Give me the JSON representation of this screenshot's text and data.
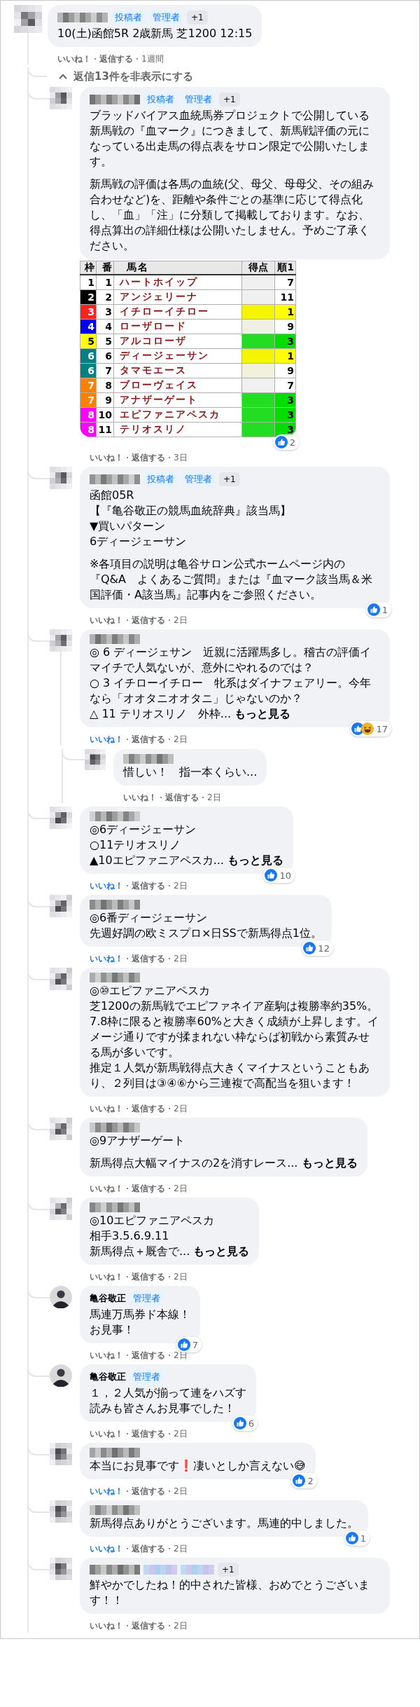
{
  "post_comment": {
    "author": {
      "kind": "blurred"
    },
    "avatar": {
      "kind": "mosaic"
    },
    "badges": [
      {
        "kind": "role",
        "label": "投稿者"
      },
      {
        "kind": "role",
        "label": "管理者"
      },
      {
        "kind": "more",
        "label": "+1"
      }
    ],
    "body": [
      [
        "10(土)函館5R 2歳新馬 芝1200 12:15"
      ]
    ],
    "actions": {
      "like": "いいね！",
      "reply": "返信する",
      "time": "1週間",
      "liked": false
    }
  },
  "toggle": {
    "label": "返信13件を非表示にする",
    "expanded": true
  },
  "replies": [
    {
      "author": {
        "kind": "blurred"
      },
      "avatar": {
        "kind": "mosaic"
      },
      "badges": [
        {
          "kind": "role",
          "label": "投稿者"
        },
        {
          "kind": "role",
          "label": "管理者"
        },
        {
          "kind": "more",
          "label": "+1"
        }
      ],
      "body": [
        [
          "ブラッドバイアス血統馬券プロジェクトで公開している新馬戦の『血マーク』につきまして、新馬戦評価の元になっている出走馬の得点表をサロン限定で公開いたします。"
        ],
        [
          "新馬戦の評価は各馬の血統(父、母父、母母父、その組み合わせなど)を、距離や条件ごとの基準に応じて得点化し、「血」「注」に分類して掲載しております。なお、得点算出の詳細仕様は公開いたしません。予めご了承ください。"
        ]
      ],
      "attachment": {
        "columns": [
          "枠",
          "番",
          "馬名",
          "得点",
          "順1"
        ],
        "rows": [
          {
            "frame": {
              "text": "1",
              "color": "#ffffff"
            },
            "number": "1",
            "name": "ハートホイップ",
            "score": {
              "color": "#f0f0f0"
            },
            "rank": {
              "text": "7",
              "color": "#ffffff"
            }
          },
          {
            "frame": {
              "text": "2",
              "color": "#000000"
            },
            "number": "2",
            "name": "アンジェリーナ",
            "score": {
              "color": "#f0f0f0"
            },
            "rank": {
              "text": "11",
              "color": "#ffffff"
            }
          },
          {
            "frame": {
              "text": "3",
              "color": "#ff2020"
            },
            "number": "3",
            "name": "イチローイチロー",
            "score": {
              "color": "#f5f500"
            },
            "rank": {
              "text": "1",
              "color": "#ffff00"
            }
          },
          {
            "frame": {
              "text": "4",
              "color": "#0000ee"
            },
            "number": "4",
            "name": "ローザロード",
            "score": {
              "color": "#f0f0e6"
            },
            "rank": {
              "text": "9",
              "color": "#ffffff"
            }
          },
          {
            "frame": {
              "text": "5",
              "color": "#ffff00"
            },
            "number": "5",
            "name": "アルコローザ",
            "score": {
              "color": "#22dd22"
            },
            "rank": {
              "text": "3",
              "color": "#00dd00"
            }
          },
          {
            "frame": {
              "text": "6",
              "color": "#008080"
            },
            "number": "6",
            "name": "ディージェーサン",
            "score": {
              "color": "#f5f500"
            },
            "rank": {
              "text": "1",
              "color": "#ffff00"
            }
          },
          {
            "frame": {
              "text": "6",
              "color": "#008080"
            },
            "number": "7",
            "name": "タマモエース",
            "score": {
              "color": "#f2f2dc"
            },
            "rank": {
              "text": "9",
              "color": "#ffffff"
            }
          },
          {
            "frame": {
              "text": "7",
              "color": "#ff8000"
            },
            "number": "8",
            "name": "ブローヴェイス",
            "score": {
              "color": "#f0f0f0"
            },
            "rank": {
              "text": "7",
              "color": "#ffffff"
            }
          },
          {
            "frame": {
              "text": "7",
              "color": "#ff8000"
            },
            "number": "9",
            "name": "アナザーゲート",
            "score": {
              "color": "#22dd22"
            },
            "rank": {
              "text": "3",
              "color": "#00dd00"
            }
          },
          {
            "frame": {
              "text": "8",
              "color": "#ff00ff"
            },
            "number": "10",
            "name": "エピファニアペスカ",
            "score": {
              "color": "#22dd22"
            },
            "rank": {
              "text": "3",
              "color": "#00dd00"
            }
          },
          {
            "frame": {
              "text": "8",
              "color": "#ff00ff"
            },
            "number": "11",
            "name": "テリオスリノ",
            "score": {
              "color": "#22dd22"
            },
            "rank": {
              "text": "3",
              "color": "#00dd00"
            }
          }
        ]
      },
      "reaction": {
        "count": "2",
        "types": [
          {
            "kind": "like"
          }
        ]
      },
      "actions": {
        "like": "いいね！",
        "reply": "返信する",
        "time": "3日",
        "liked": false
      }
    },
    {
      "author": {
        "kind": "blurred"
      },
      "avatar": {
        "kind": "mosaic"
      },
      "badges": [
        {
          "kind": "role",
          "label": "投稿者"
        },
        {
          "kind": "role",
          "label": "管理者"
        },
        {
          "kind": "more",
          "label": "+1"
        }
      ],
      "body": [
        [
          "函館05R",
          "【『亀谷敬正の競馬血統辞典』該当馬】",
          "▼買いパターン",
          "6ディージェーサン"
        ],
        [
          "※各項目の説明は亀谷サロン公式ホームページ内の『Q&A　よくあるご質問』または『血マーク該当馬＆米国評価・A該当馬』記事内をご参照ください。"
        ]
      ],
      "reaction": {
        "count": "1",
        "types": [
          {
            "kind": "like"
          }
        ]
      },
      "actions": {
        "like": "いいね！",
        "reply": "返信する",
        "time": "2日",
        "liked": false
      }
    },
    {
      "author": {
        "kind": "blurred"
      },
      "avatar": {
        "kind": "mosaic"
      },
      "body": [
        [
          "◎ 6 ディージェサン　近親に活躍馬多し。稽古の評価イマイチで人気ないが、意外にやれるのでは？",
          "○ 3 イチローイチロー　牝系はダイナフェアリー。今年なら「オオタニオオタニ」じゃないのか？",
          "△ 11 テリオスリノ　外枠..."
        ]
      ],
      "see_more": "もっと見る",
      "reaction": {
        "count": "17",
        "types": [
          {
            "kind": "like"
          },
          {
            "kind": "haha"
          }
        ]
      },
      "actions": {
        "like": "いいね！",
        "reply": "返信する",
        "time": "2日",
        "liked": true
      },
      "replies": [
        {
          "author": {
            "kind": "blurred"
          },
          "avatar": {
            "kind": "mosaic"
          },
          "body": [
            [
              "惜しい！　指一本くらい..."
            ]
          ],
          "actions": {
            "like": "いいね！",
            "reply": "返信する",
            "time": "2日",
            "liked": false
          }
        }
      ]
    },
    {
      "author": {
        "kind": "blurred"
      },
      "avatar": {
        "kind": "mosaic"
      },
      "body": [
        [
          "◎6ディージェーサン",
          "○11テリオスリノ",
          "▲10エピファニアペスカ..."
        ]
      ],
      "see_more": "もっと見る",
      "reaction": {
        "count": "10",
        "types": [
          {
            "kind": "like"
          }
        ]
      },
      "actions": {
        "like": "いいね！",
        "reply": "返信する",
        "time": "2日",
        "liked": true
      }
    },
    {
      "author": {
        "kind": "blurred"
      },
      "avatar": {
        "kind": "mosaic"
      },
      "body": [
        [
          "◎6番ディージェーサン",
          "先週好調の欧ミスプロ×日SSで新馬得点1位。"
        ]
      ],
      "reaction": {
        "count": "12",
        "types": [
          {
            "kind": "like"
          }
        ]
      },
      "actions": {
        "like": "いいね！",
        "reply": "返信する",
        "time": "2日",
        "liked": true
      }
    },
    {
      "author": {
        "kind": "blurred"
      },
      "avatar": {
        "kind": "mosaic"
      },
      "body": [
        [
          "◎⑩エピファニアペスカ",
          "芝1200の新馬戦でエピファネイア産駒は複勝率約35%。7.8枠に限ると複勝率60%と大きく成績が上昇します。イメージ通りですが揉まれない枠ならば初戦から素質みせる馬が多いです。",
          "推定１人気が新馬戦得点大きくマイナスということもあり、２列目は③④⑥から三連複で高配当を狙います！"
        ]
      ],
      "actions": {
        "like": "いいね！",
        "reply": "返信する",
        "time": "2日",
        "liked": false
      }
    },
    {
      "author": {
        "kind": "blurred"
      },
      "avatar": {
        "kind": "mosaic"
      },
      "body": [
        [
          "◎9アナザーゲート"
        ],
        [
          "新馬得点大幅マイナスの2を消すレース..."
        ]
      ],
      "see_more": "もっと見る",
      "actions": {
        "like": "いいね！",
        "reply": "返信する",
        "time": "2日",
        "liked": false
      }
    },
    {
      "author": {
        "kind": "blurred"
      },
      "avatar": {
        "kind": "mosaic"
      },
      "body": [
        [
          "◎10エピファニアペスカ",
          "相手3.5.6.9.11",
          "新馬得点＋厩舎で..."
        ]
      ],
      "see_more": "もっと見る",
      "actions": {
        "like": "いいね！",
        "reply": "返信する",
        "time": "2日",
        "liked": false
      }
    },
    {
      "author": {
        "kind": "named",
        "name": "亀谷敬正"
      },
      "avatar": {
        "kind": "photo"
      },
      "badges": [
        {
          "kind": "role",
          "label": "管理者"
        }
      ],
      "body": [
        [
          "馬連万馬券ド本線！",
          "お見事！"
        ]
      ],
      "reaction": {
        "count": "7",
        "types": [
          {
            "kind": "like"
          }
        ]
      },
      "actions": {
        "like": "いいね！",
        "reply": "返信する",
        "time": "2日",
        "liked": false
      }
    },
    {
      "author": {
        "kind": "named",
        "name": "亀谷敬正"
      },
      "avatar": {
        "kind": "photo"
      },
      "badges": [
        {
          "kind": "role",
          "label": "管理者"
        }
      ],
      "body": [
        [
          "１，２人気が揃って連をハズす",
          "読みも皆さんお見事でした！"
        ]
      ],
      "reaction": {
        "count": "6",
        "types": [
          {
            "kind": "like"
          }
        ]
      },
      "actions": {
        "like": "いいね！",
        "reply": "返信する",
        "time": "2日",
        "liked": false
      }
    },
    {
      "author": {
        "kind": "blurred"
      },
      "avatar": {
        "kind": "mosaic"
      },
      "body": [
        [
          "本当にお見事です❗凄いとしか言えない😅"
        ]
      ],
      "reaction": {
        "count": "2",
        "types": [
          {
            "kind": "like"
          }
        ]
      },
      "actions": {
        "like": "いいね！",
        "reply": "返信する",
        "time": "2日",
        "liked": true
      }
    },
    {
      "author": {
        "kind": "blurred"
      },
      "avatar": {
        "kind": "mosaic"
      },
      "body": [
        [
          "新馬得点ありがとうございます。馬連的中しました。"
        ]
      ],
      "reaction": {
        "count": "1",
        "types": [
          {
            "kind": "like"
          }
        ]
      },
      "actions": {
        "like": "いいね！",
        "reply": "返信する",
        "time": "2日",
        "liked": true
      }
    },
    {
      "author": {
        "kind": "blurred"
      },
      "avatar": {
        "kind": "mosaic"
      },
      "badges": [
        {
          "kind": "blurred"
        },
        {
          "kind": "blurred"
        },
        {
          "kind": "more",
          "label": "+1"
        }
      ],
      "body": [
        [
          "鮮やかでしたね！的中された皆様、おめでとうございます！！"
        ]
      ],
      "actions": {
        "like": "いいね！",
        "reply": "返信する",
        "time": "2日",
        "liked": false
      }
    }
  ]
}
